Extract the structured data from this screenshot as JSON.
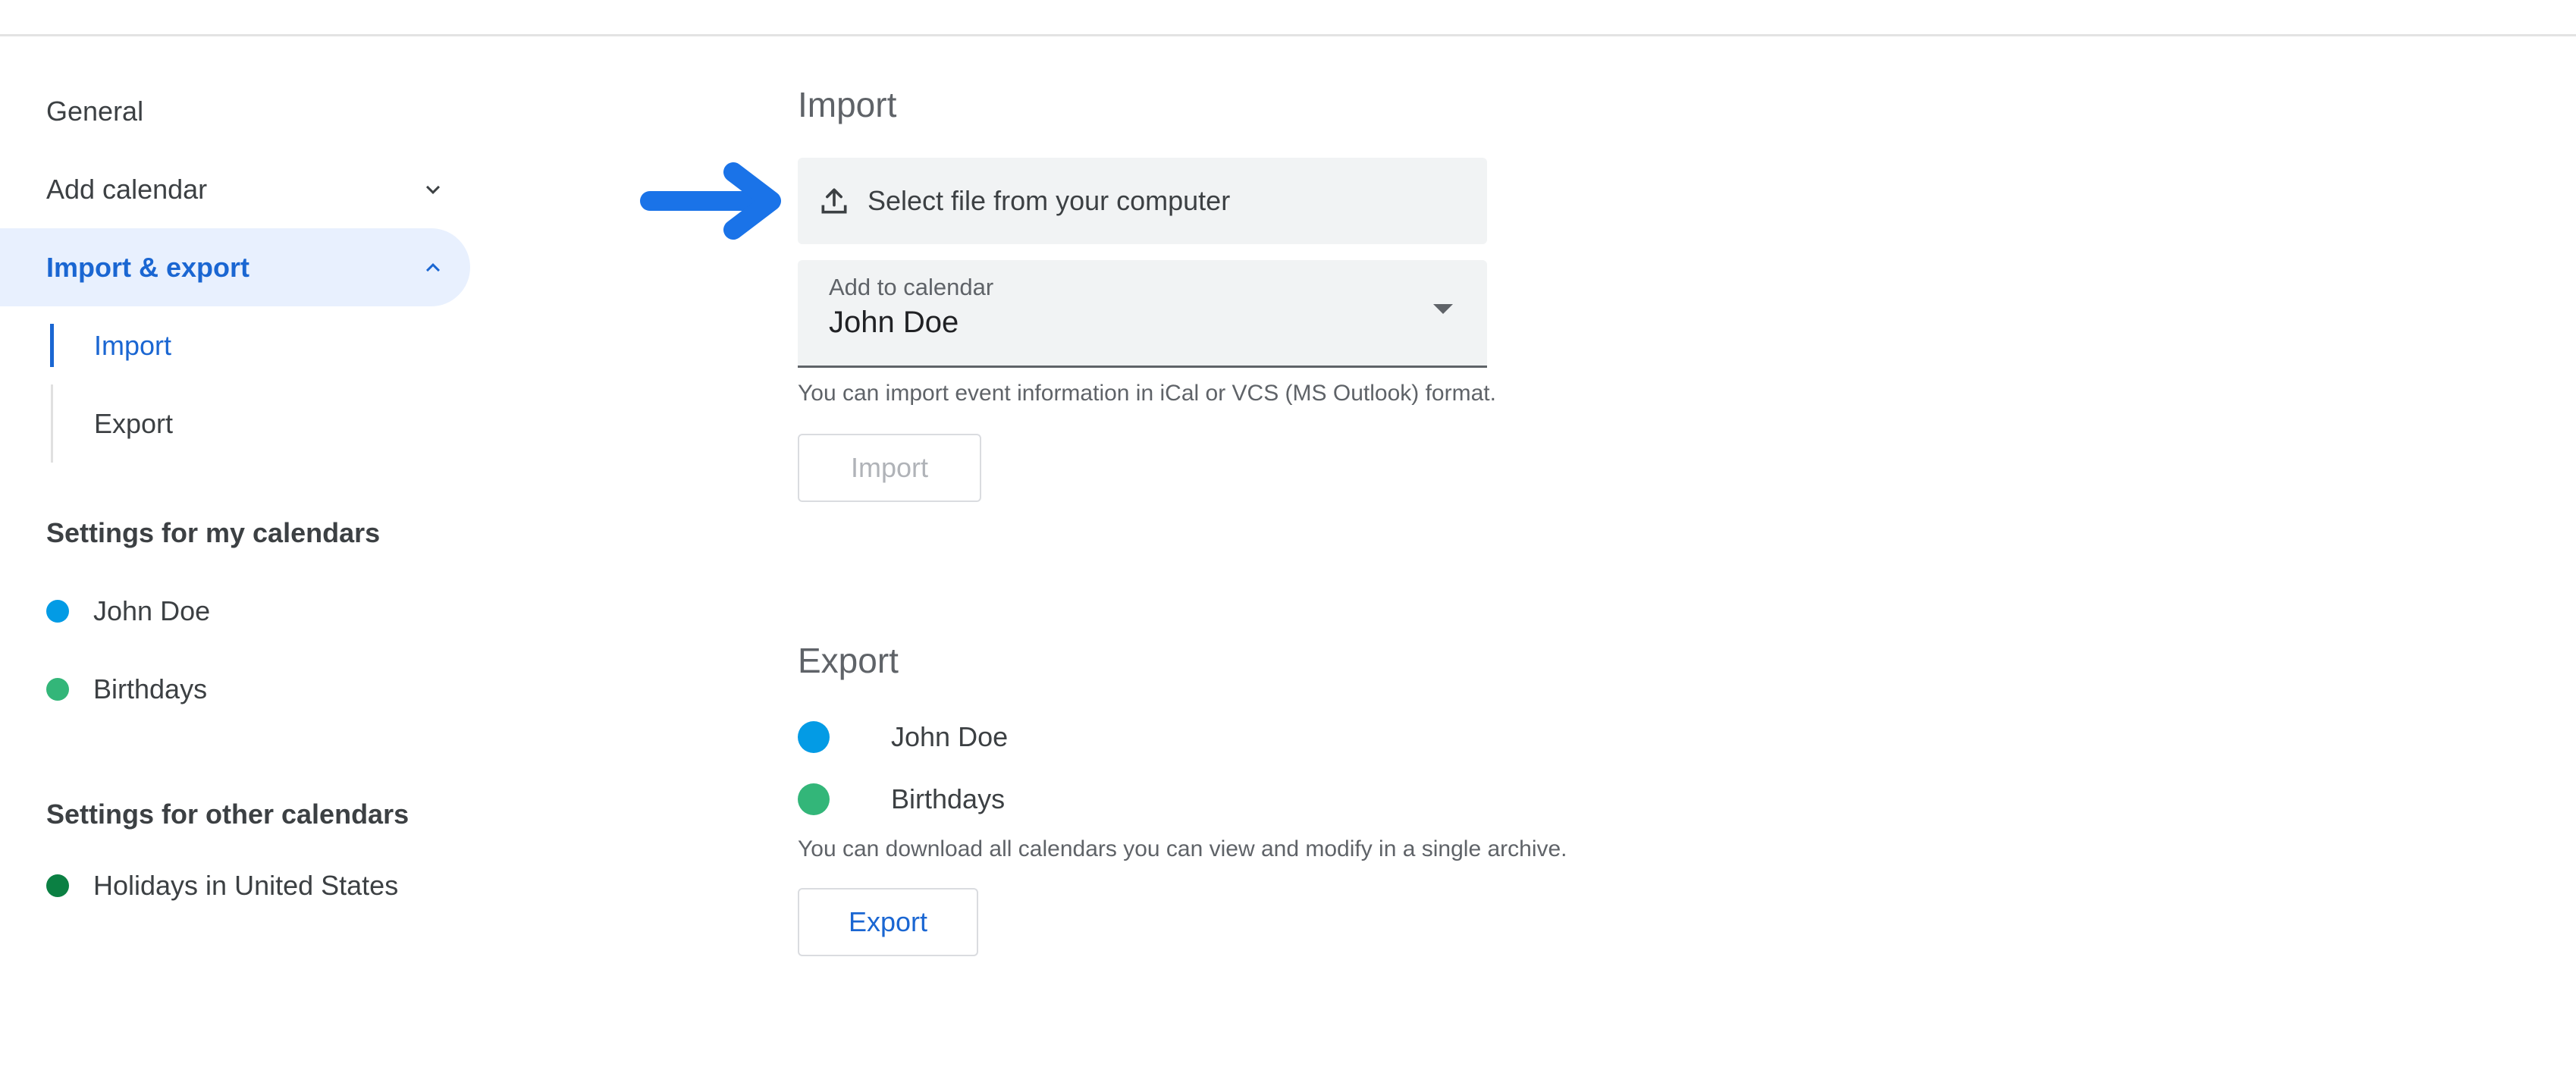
{
  "sidebar": {
    "general": "General",
    "add_calendar": "Add calendar",
    "import_export": "Import & export",
    "sub_import": "Import",
    "sub_export": "Export",
    "my_calendars_title": "Settings for my calendars",
    "my_calendars": [
      {
        "label": "John Doe",
        "color": "#039be5"
      },
      {
        "label": "Birthdays",
        "color": "#33b679"
      }
    ],
    "other_calendars_title": "Settings for other calendars",
    "other_calendars": [
      {
        "label": "Holidays in United States",
        "color": "#0b8043"
      }
    ]
  },
  "import": {
    "title": "Import",
    "file_button": "Select file from your computer",
    "add_to_label": "Add to calendar",
    "add_to_value": "John Doe",
    "help": "You can import event information in iCal or VCS (MS Outlook) format.",
    "button": "Import"
  },
  "export": {
    "title": "Export",
    "calendars": [
      {
        "label": "John Doe",
        "color": "#039be5"
      },
      {
        "label": "Birthdays",
        "color": "#33b679"
      }
    ],
    "help": "You can download all calendars you can view and modify in a single archive.",
    "button": "Export"
  },
  "colors": {
    "accent": "#1a66d2",
    "active_bg": "#e8f0fe",
    "arrow": "#1a73e8"
  }
}
